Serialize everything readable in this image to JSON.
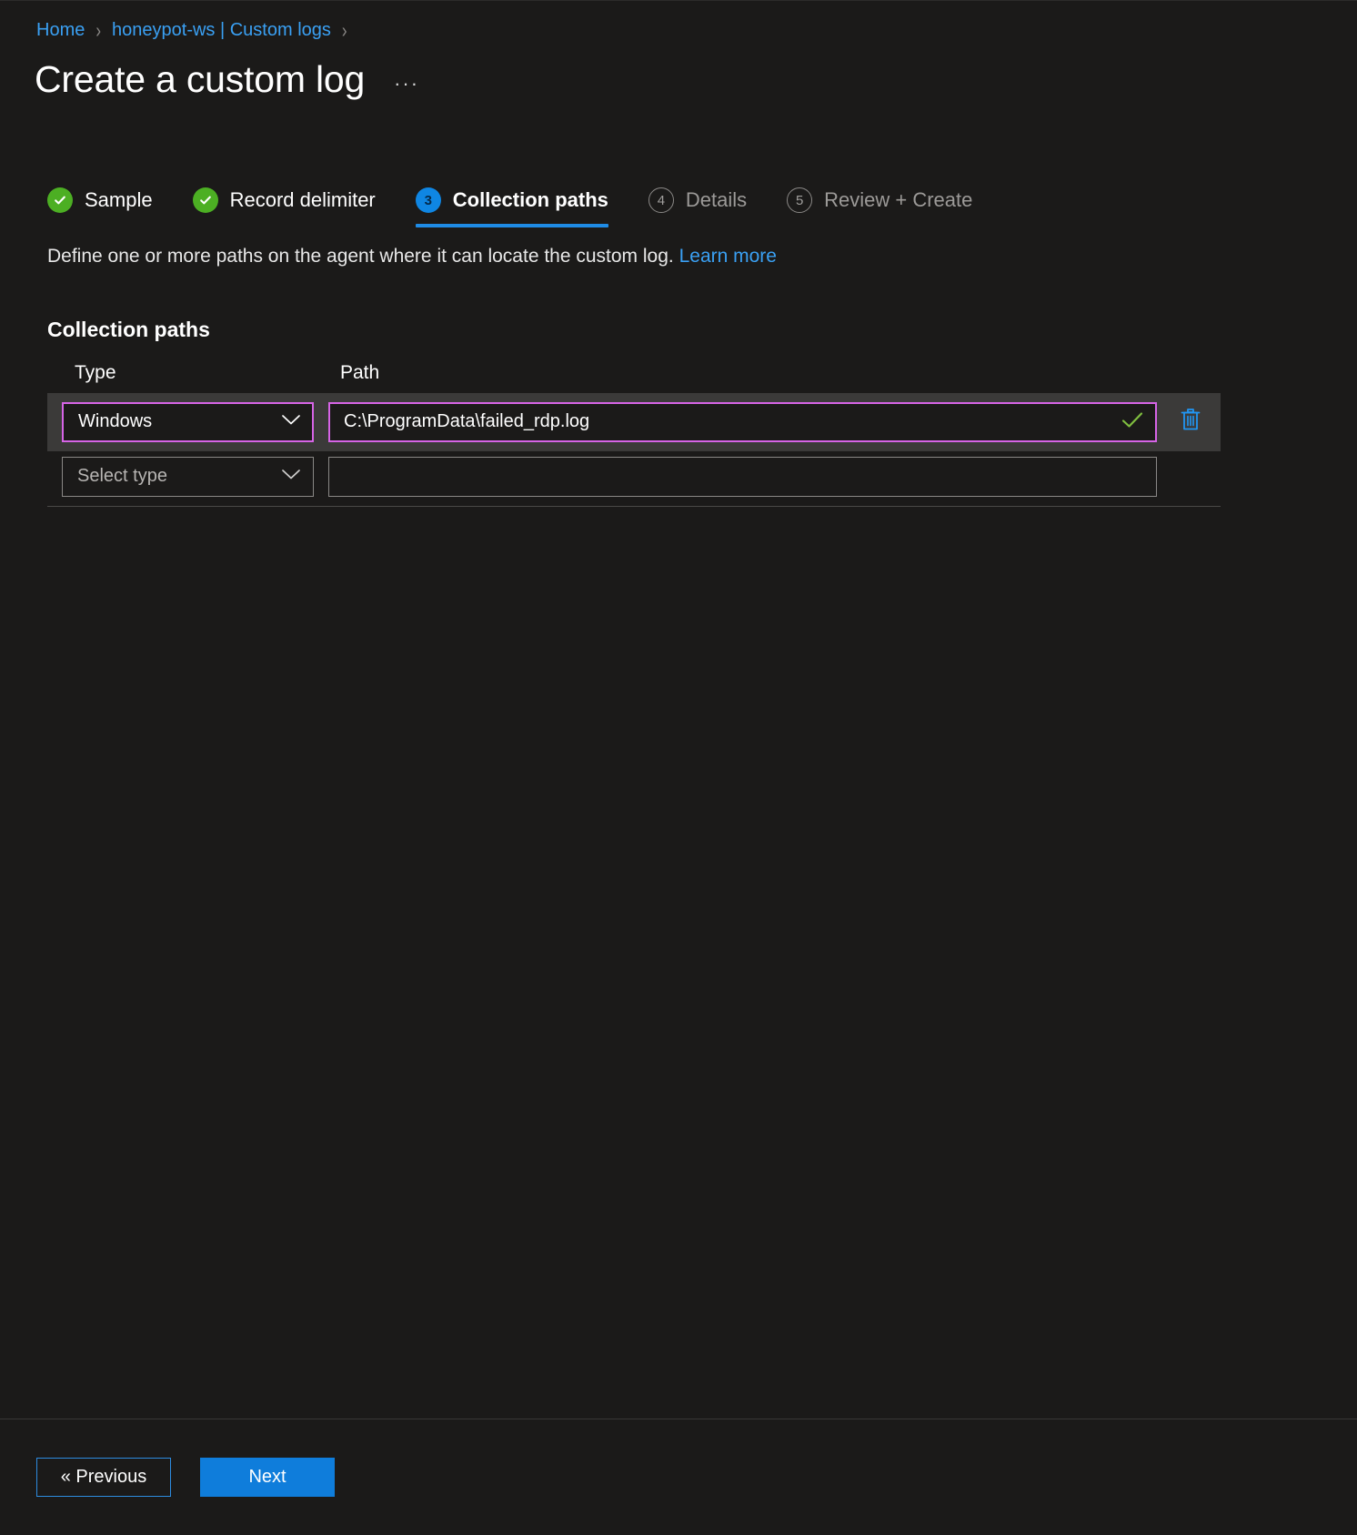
{
  "breadcrumb": {
    "items": [
      {
        "label": "Home"
      },
      {
        "label": "honeypot-ws | Custom logs"
      }
    ],
    "separator": "›"
  },
  "header": {
    "title": "Create a custom log",
    "more_label": "···"
  },
  "wizard": {
    "steps": [
      {
        "number": "1",
        "label": "Sample",
        "state": "done"
      },
      {
        "number": "2",
        "label": "Record delimiter",
        "state": "done"
      },
      {
        "number": "3",
        "label": "Collection paths",
        "state": "current"
      },
      {
        "number": "4",
        "label": "Details",
        "state": "upcoming"
      },
      {
        "number": "5",
        "label": "Review + Create",
        "state": "upcoming"
      }
    ]
  },
  "description": {
    "text": "Define one or more paths on the agent where it can locate the custom log.",
    "link_label": "Learn more"
  },
  "collection_paths": {
    "heading": "Collection paths",
    "columns": {
      "type": "Type",
      "path": "Path"
    },
    "rows": [
      {
        "type_value": "Windows",
        "path_value": "C:\\ProgramData\\failed_rdp.log",
        "focused": true,
        "valid": true,
        "deletable": true
      },
      {
        "type_value": "Select type",
        "path_value": "",
        "focused": false,
        "valid": false,
        "deletable": false
      }
    ]
  },
  "footer": {
    "previous_label": "« Previous",
    "next_label": "Next"
  },
  "colors": {
    "page_background": "#1b1a19",
    "link": "#3aa0f3",
    "accent": "#0f7ddb",
    "focus_border": "#d664e6",
    "success": "#4caf23",
    "step_active_underline": "#1f8ce6"
  }
}
